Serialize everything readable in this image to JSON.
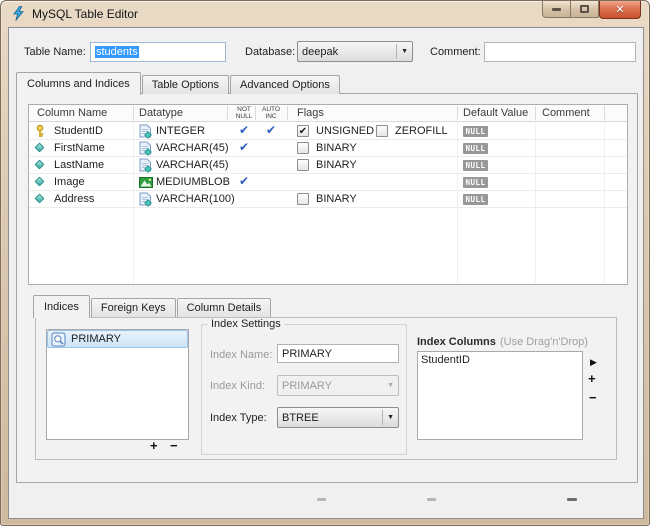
{
  "window": {
    "title": "MySQL Table Editor"
  },
  "symbols": {
    "check": "✔",
    "close": "✕",
    "plus": "+",
    "minus": "−",
    "arrow_right": "▶",
    "dropdown_arrow": "▼"
  },
  "colors": {
    "frame_tan": "#dcc9b1",
    "close_red": "#c8512f",
    "selection_blue": "#3399ff",
    "check_blue": "#2a5fb8",
    "null_badge_gray": "#989898",
    "list_selection": "#cde4f7"
  },
  "header": {
    "table_name_label": "Table Name:",
    "table_name_value": "students",
    "database_label": "Database:",
    "database_value": "deepak",
    "comment_label": "Comment:",
    "comment_value": ""
  },
  "tabs": {
    "main": [
      {
        "label": "Columns and Indices",
        "active": true
      },
      {
        "label": "Table Options",
        "active": false
      },
      {
        "label": "Advanced Options",
        "active": false
      }
    ],
    "lower": [
      {
        "label": "Indices",
        "active": true
      },
      {
        "label": "Foreign Keys",
        "active": false
      },
      {
        "label": "Column Details",
        "active": false
      }
    ]
  },
  "grid": {
    "headers": {
      "column_name": "Column Name",
      "datatype": "Datatype",
      "not_null_1": "NOT",
      "not_null_2": "NULL",
      "auto_inc_1": "AUTO",
      "auto_inc_2": "INC",
      "flags": "Flags",
      "default_value": "Default Value",
      "comment": "Comment"
    },
    "rows": [
      {
        "name": "StudentID",
        "icon": "primary-key-icon",
        "datatype": "INTEGER",
        "not_null": true,
        "auto_inc": true,
        "flags": [
          {
            "label": "UNSIGNED",
            "checked": true
          },
          {
            "label": "ZEROFILL",
            "checked": false
          }
        ],
        "default": "NULL",
        "comment": ""
      },
      {
        "name": "FirstName",
        "icon": "column-diamond-icon",
        "datatype": "VARCHAR(45)",
        "not_null": true,
        "auto_inc": false,
        "flags": [
          {
            "label": "BINARY",
            "checked": false
          }
        ],
        "default": "NULL",
        "comment": ""
      },
      {
        "name": "LastName",
        "icon": "column-diamond-icon",
        "datatype": "VARCHAR(45)",
        "not_null": false,
        "auto_inc": false,
        "flags": [
          {
            "label": "BINARY",
            "checked": false
          }
        ],
        "default": "NULL",
        "comment": ""
      },
      {
        "name": "Image",
        "icon": "column-diamond-icon",
        "datatype": "MEDIUMBLOB",
        "not_null": true,
        "auto_inc": false,
        "flags": [],
        "default": "NULL",
        "comment": ""
      },
      {
        "name": "Address",
        "icon": "column-diamond-icon",
        "datatype": "VARCHAR(100)",
        "not_null": false,
        "auto_inc": false,
        "flags": [
          {
            "label": "BINARY",
            "checked": false
          }
        ],
        "default": "NULL",
        "comment": ""
      }
    ]
  },
  "indices_panel": {
    "list": [
      {
        "label": "PRIMARY",
        "selected": true
      }
    ],
    "settings": {
      "group_label": "Index Settings",
      "name_label": "Index Name:",
      "name_value": "PRIMARY",
      "kind_label": "Index Kind:",
      "kind_value": "PRIMARY",
      "type_label": "Index Type:",
      "type_value": "BTREE"
    },
    "columns": {
      "label": "Index Columns",
      "hint": "(Use Drag'n'Drop)",
      "items": [
        "StudentID"
      ]
    }
  }
}
